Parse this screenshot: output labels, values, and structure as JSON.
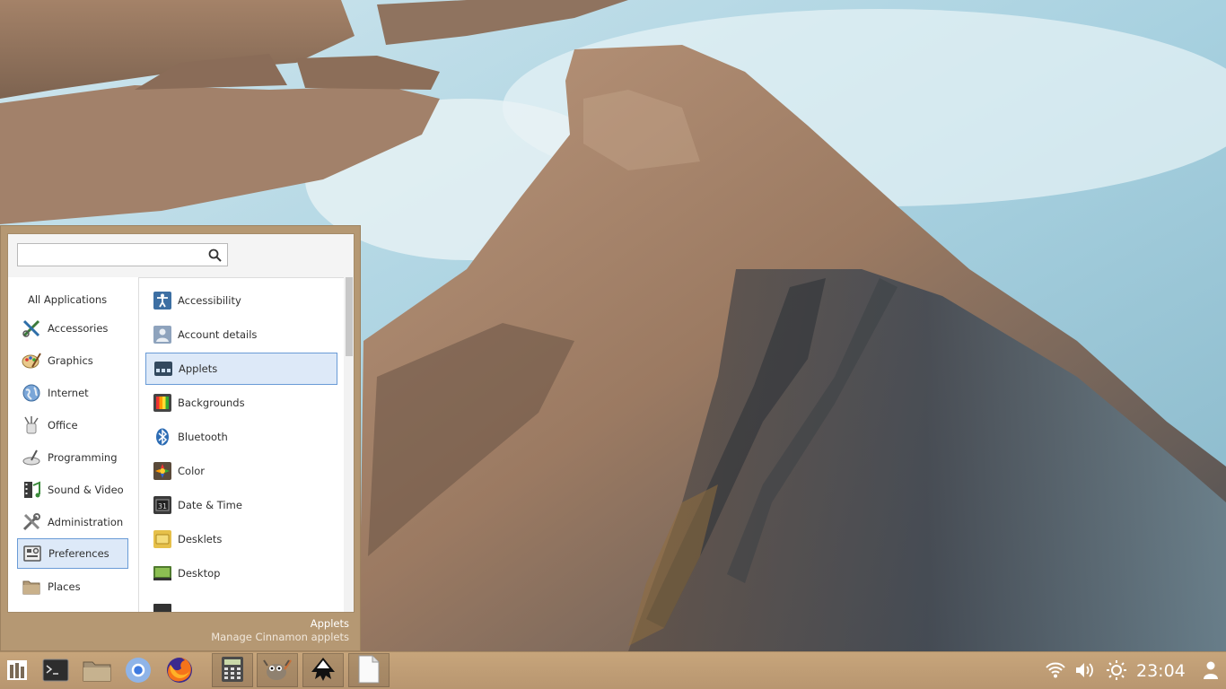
{
  "search": {
    "placeholder": "",
    "value": ""
  },
  "categories": [
    {
      "label": "All Applications",
      "icon": "none",
      "selected": false
    },
    {
      "label": "Accessories",
      "icon": "accessories-icon",
      "selected": false
    },
    {
      "label": "Graphics",
      "icon": "graphics-icon",
      "selected": false
    },
    {
      "label": "Internet",
      "icon": "internet-icon",
      "selected": false
    },
    {
      "label": "Office",
      "icon": "office-icon",
      "selected": false
    },
    {
      "label": "Programming",
      "icon": "programming-icon",
      "selected": false
    },
    {
      "label": "Sound & Video",
      "icon": "sound-video-icon",
      "selected": false
    },
    {
      "label": "Administration",
      "icon": "administration-icon",
      "selected": false
    },
    {
      "label": "Preferences",
      "icon": "preferences-icon",
      "selected": true
    },
    {
      "label": "Places",
      "icon": "places-folder-icon",
      "selected": false
    }
  ],
  "apps": [
    {
      "label": "Accessibility",
      "icon": "accessibility-icon",
      "selected": false
    },
    {
      "label": "Account details",
      "icon": "account-icon",
      "selected": false
    },
    {
      "label": "Applets",
      "icon": "applets-icon",
      "selected": true
    },
    {
      "label": "Backgrounds",
      "icon": "backgrounds-icon",
      "selected": false
    },
    {
      "label": "Bluetooth",
      "icon": "bluetooth-icon",
      "selected": false
    },
    {
      "label": "Color",
      "icon": "color-icon",
      "selected": false
    },
    {
      "label": "Date & Time",
      "icon": "date-time-icon",
      "selected": false
    },
    {
      "label": "Desklets",
      "icon": "desklets-icon",
      "selected": false
    },
    {
      "label": "Desktop",
      "icon": "desktop-icon",
      "selected": false
    }
  ],
  "description": {
    "title": "Applets",
    "subtitle": "Manage Cinnamon applets"
  },
  "panel": {
    "launchers": [
      "menu-icon",
      "terminal-icon",
      "files-icon",
      "chromium-icon",
      "firefox-icon"
    ],
    "windows": [
      "calculator-icon",
      "gimp-icon",
      "inkscape-icon",
      "text-document-icon"
    ],
    "tray": [
      "wifi-icon",
      "volume-icon",
      "brightness-icon"
    ],
    "clock": "23:04",
    "user_icon": "user-icon"
  },
  "colors": {
    "selection_bg": "#dde9f8",
    "selection_border": "#6a9bd6",
    "panel": "#c0a078"
  }
}
